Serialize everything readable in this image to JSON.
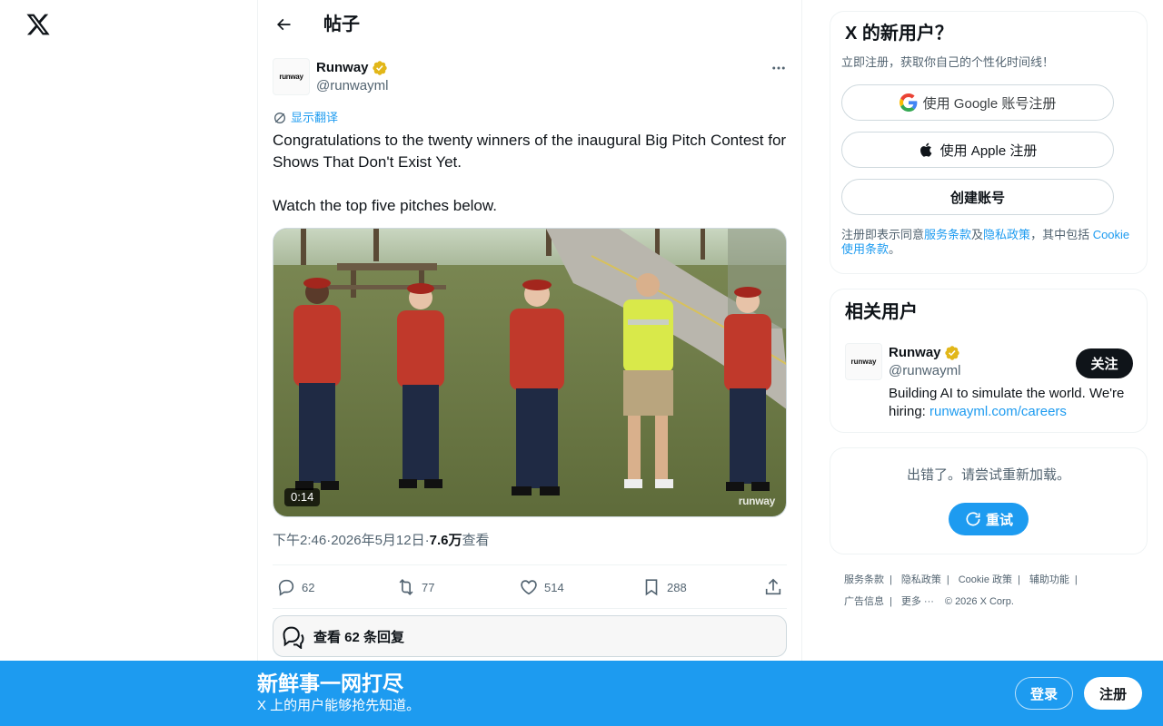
{
  "nav": {
    "logo_icon": "x-logo-icon"
  },
  "header": {
    "title": "帖子",
    "back_icon": "arrow-left-icon"
  },
  "post": {
    "author": {
      "name": "Runway",
      "handle": "@runwayml",
      "avatar_text": "runway",
      "verified": true,
      "verified_color": "#e2b719"
    },
    "translate_label": "显示翻译",
    "text_lines": [
      "Congratulations to the twenty winners of the inaugural Big Pitch Contest for Shows That Don't Exist Yet.",
      "",
      "Watch the top five pitches below."
    ],
    "video": {
      "duration": "0:14",
      "watermark": "runway"
    },
    "time": "下午2:46",
    "dot": " · ",
    "date": "2026年5月12日",
    "views": "7.6万",
    "views_label": " 查看",
    "stats": {
      "replies": "62",
      "reposts": "77",
      "likes": "514",
      "bookmarks": "288"
    },
    "view_replies_label": "查看 62 条回复"
  },
  "signup": {
    "title": "X 的新用户？",
    "subtitle": "立即注册，获取你自己的个性化时间线！",
    "google_label": "使用 Google 账号注册",
    "apple_label": "使用 Apple 注册",
    "create_label": "创建账号",
    "terms": {
      "prefix": "注册即表示同意",
      "tos": "服务条款",
      "and": "及",
      "privacy": "隐私政策",
      "middle": "，其中包括 ",
      "cookie": "Cookie 使用条款",
      "suffix": "。"
    }
  },
  "related": {
    "title": "相关用户",
    "user": {
      "name": "Runway",
      "handle": "@runwayml",
      "avatar_text": "runway",
      "follow_label": "关注",
      "bio_prefix": "Building AI to simulate the world. We're hiring: ",
      "bio_link": "runwayml.com/careers"
    }
  },
  "error": {
    "message": "出错了。请尝试重新加载。",
    "retry_label": "重试"
  },
  "footer": {
    "row1": [
      "服务条款",
      "隐私政策",
      "Cookie 政策",
      "辅助功能"
    ],
    "row2": [
      "广告信息",
      "更多 ···"
    ],
    "copyright": "© 2026 X Corp."
  },
  "banner": {
    "title": "新鲜事一网打尽",
    "subtitle": "X 上的用户能够抢先知道。",
    "login_label": "登录",
    "register_label": "注册"
  },
  "colors": {
    "accent": "#1d9bf0",
    "text": "#0f1419",
    "muted": "#536471",
    "border": "#eff3f4"
  }
}
